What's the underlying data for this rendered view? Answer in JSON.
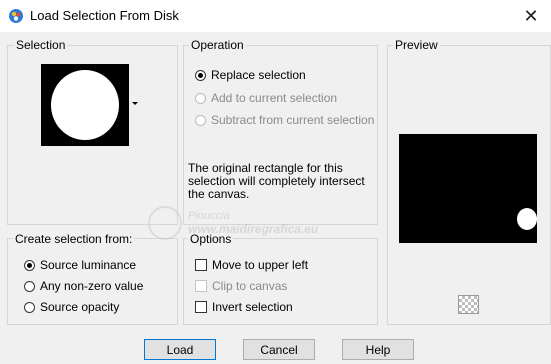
{
  "window": {
    "title": "Load Selection From Disk"
  },
  "icons": {
    "app": "paint-shop-pro-icon",
    "close": "close-icon",
    "checker": "checkerboard-icon",
    "dropdown": "chevron-down-icon"
  },
  "selection": {
    "label": "Selection"
  },
  "operation": {
    "label": "Operation",
    "options": [
      {
        "label": "Replace selection",
        "checked": true,
        "disabled": false
      },
      {
        "label": "Add to current selection",
        "checked": false,
        "disabled": true
      },
      {
        "label": "Subtract from current selection",
        "checked": false,
        "disabled": true
      }
    ],
    "info": "The original rectangle for this selection will completely intersect the canvas."
  },
  "preview": {
    "label": "Preview"
  },
  "create_from": {
    "label": "Create selection from:",
    "options": [
      {
        "label": "Source luminance",
        "checked": true
      },
      {
        "label": "Any non-zero value",
        "checked": false
      },
      {
        "label": "Source opacity",
        "checked": false
      }
    ]
  },
  "options": {
    "label": "Options",
    "items": [
      {
        "label": "Move to upper left",
        "checked": false,
        "disabled": false
      },
      {
        "label": "Clip to canvas",
        "checked": false,
        "disabled": true
      },
      {
        "label": "Invert selection",
        "checked": false,
        "disabled": false
      }
    ]
  },
  "buttons": {
    "load": "Load",
    "cancel": "Cancel",
    "help": "Help"
  },
  "watermark": {
    "line1": "Pinuccia",
    "line2": "www.maidiregrafica.eu"
  }
}
